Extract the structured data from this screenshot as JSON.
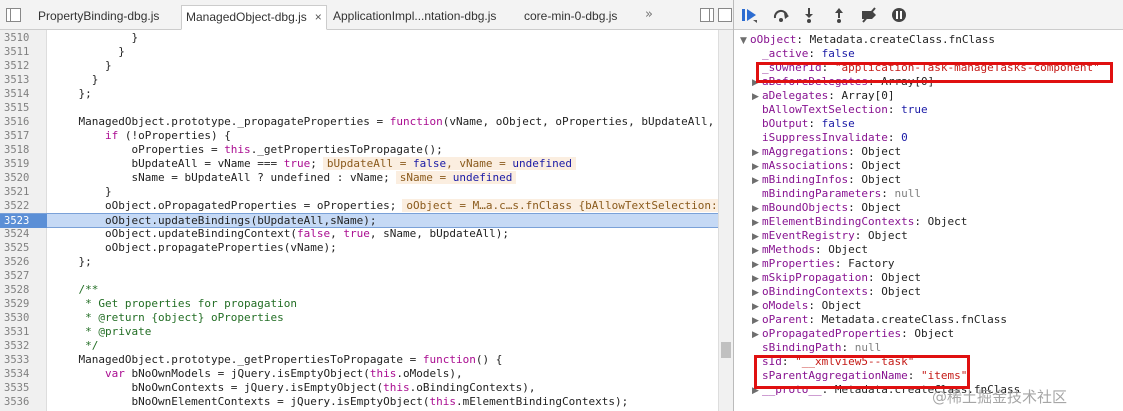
{
  "tabs": [
    {
      "label": "PropertyBinding-dbg.js",
      "active": false
    },
    {
      "label": "ManagedObject-dbg.js",
      "active": true,
      "close": "×"
    },
    {
      "label": "ApplicationImpl...ntation-dbg.js",
      "active": false
    },
    {
      "label": "core-min-0-dbg.js",
      "active": false
    }
  ],
  "tabbar": {
    "overflow": "»"
  },
  "editor": {
    "lines": [
      {
        "no": "3510",
        "html": "            }"
      },
      {
        "no": "3511",
        "html": "          }"
      },
      {
        "no": "3512",
        "html": "        }"
      },
      {
        "no": "3513",
        "html": "      }"
      },
      {
        "no": "3514",
        "html": "    };"
      },
      {
        "no": "3515",
        "html": ""
      },
      {
        "no": "3516",
        "html": "    ManagedObject.prototype._propagateProperties = <span class=\"kw\">function</span>(vName, oObject, oProperties, bUpdateAll,"
      },
      {
        "no": "3517",
        "html": "        <span class=\"kw\">if</span> (!oProperties) {"
      },
      {
        "no": "3518",
        "html": "            oProperties = <span class=\"kw\">this</span>._getPropertiesToPropagate();"
      },
      {
        "no": "3519",
        "html": "            bUpdateAll = vName === <span class=\"kw\">true</span>;<span class=\"inl\">bUpdateAll = <span class=\"v\">false</span>, vName = <span class=\"v\">undefined</span></span>"
      },
      {
        "no": "3520",
        "html": "            sName = bUpdateAll ? undefined : vName;<span class=\"inl\">sName = <span class=\"v\">undefined</span></span>"
      },
      {
        "no": "3521",
        "html": "        }"
      },
      {
        "no": "3522",
        "html": "        oObject.oPropagatedProperties = oProperties;<span class=\"inl\">oObject = M…a.c…s.fnClass {bAllowTextSelection:</span>"
      },
      {
        "no": "3523",
        "html": "        oObject.updateBindings(bUpdateAll,sName);",
        "exec": true
      },
      {
        "no": "3524",
        "html": "        oObject.updateBindingContext(<span class=\"kw\">false</span>, <span class=\"kw\">true</span>, sName, bUpdateAll);"
      },
      {
        "no": "3525",
        "html": "        oObject.propagateProperties(vName);"
      },
      {
        "no": "3526",
        "html": "    };"
      },
      {
        "no": "3527",
        "html": ""
      },
      {
        "no": "3528",
        "html": "    <span class=\"cmt\">/**</span>"
      },
      {
        "no": "3529",
        "html": "<span class=\"cmt\">     * Get properties for propagation</span>"
      },
      {
        "no": "3530",
        "html": "<span class=\"cmt\">     * @return {object} oProperties</span>"
      },
      {
        "no": "3531",
        "html": "<span class=\"cmt\">     * @private</span>"
      },
      {
        "no": "3532",
        "html": "<span class=\"cmt\">     */</span>"
      },
      {
        "no": "3533",
        "html": "    ManagedObject.prototype._getPropertiesToPropagate = <span class=\"kw\">function</span>() {"
      },
      {
        "no": "3534",
        "html": "        <span class=\"kw\">var</span> bNoOwnModels = jQuery.isEmptyObject(<span class=\"kw\">this</span>.oModels),"
      },
      {
        "no": "3535",
        "html": "            bNoOwnContexts = jQuery.isEmptyObject(<span class=\"kw\">this</span>.oBindingContexts),"
      },
      {
        "no": "3536",
        "html": "            bNoOwnElementContexts = jQuery.isEmptyObject(<span class=\"kw\">this</span>.mElementBindingContexts);"
      }
    ]
  },
  "scope": {
    "items": [
      {
        "tri": "▼",
        "key": "oObject",
        "val": "Metadata.createClass.fnClass",
        "vt": "obj",
        "indent": 0
      },
      {
        "tri": "",
        "key": "_active",
        "val": "false",
        "vt": "bool",
        "indent": 1
      },
      {
        "tri": "",
        "key": "_sOwnerId",
        "val": "\"application-Task-manageTasks-component\"",
        "vt": "str",
        "indent": 1
      },
      {
        "tri": "▶",
        "key": "aBeforeDelegates",
        "val": "Array[0]",
        "vt": "obj",
        "indent": 1
      },
      {
        "tri": "▶",
        "key": "aDelegates",
        "val": "Array[0]",
        "vt": "obj",
        "indent": 1
      },
      {
        "tri": "",
        "key": "bAllowTextSelection",
        "val": "true",
        "vt": "bool",
        "indent": 1
      },
      {
        "tri": "",
        "key": "bOutput",
        "val": "false",
        "vt": "bool",
        "indent": 1
      },
      {
        "tri": "",
        "key": "iSuppressInvalidate",
        "val": "0",
        "vt": "num",
        "indent": 1
      },
      {
        "tri": "▶",
        "key": "mAggregations",
        "val": "Object",
        "vt": "obj",
        "indent": 1
      },
      {
        "tri": "▶",
        "key": "mAssociations",
        "val": "Object",
        "vt": "obj",
        "indent": 1
      },
      {
        "tri": "▶",
        "key": "mBindingInfos",
        "val": "Object",
        "vt": "obj",
        "indent": 1
      },
      {
        "tri": "",
        "key": "mBindingParameters",
        "val": "null",
        "vt": "null",
        "indent": 1
      },
      {
        "tri": "▶",
        "key": "mBoundObjects",
        "val": "Object",
        "vt": "obj",
        "indent": 1
      },
      {
        "tri": "▶",
        "key": "mElementBindingContexts",
        "val": "Object",
        "vt": "obj",
        "indent": 1
      },
      {
        "tri": "▶",
        "key": "mEventRegistry",
        "val": "Object",
        "vt": "obj",
        "indent": 1
      },
      {
        "tri": "▶",
        "key": "mMethods",
        "val": "Object",
        "vt": "obj",
        "indent": 1
      },
      {
        "tri": "▶",
        "key": "mProperties",
        "val": "Factory",
        "vt": "obj",
        "indent": 1
      },
      {
        "tri": "▶",
        "key": "mSkipPropagation",
        "val": "Object",
        "vt": "obj",
        "indent": 1
      },
      {
        "tri": "▶",
        "key": "oBindingContexts",
        "val": "Object",
        "vt": "obj",
        "indent": 1
      },
      {
        "tri": "▶",
        "key": "oModels",
        "val": "Object",
        "vt": "obj",
        "indent": 1
      },
      {
        "tri": "▶",
        "key": "oParent",
        "val": "Metadata.createClass.fnClass",
        "vt": "obj",
        "indent": 1
      },
      {
        "tri": "▶",
        "key": "oPropagatedProperties",
        "val": "Object",
        "vt": "obj",
        "indent": 1
      },
      {
        "tri": "",
        "key": "sBindingPath",
        "val": "null",
        "vt": "null",
        "indent": 1
      },
      {
        "tri": "",
        "key": "sId",
        "val": "\"__xmlview5--task\"",
        "vt": "str",
        "indent": 1
      },
      {
        "tri": "",
        "key": "sParentAggregationName",
        "val": "\"items\"",
        "vt": "str",
        "indent": 1
      },
      {
        "tri": "▶",
        "key": "__proto__",
        "val": "Metadata.createClass.fnClass",
        "vt": "obj",
        "indent": 1
      }
    ]
  },
  "watermark": "@稀土掘金技术社区",
  "colors": {
    "highlight_box": "#e01010",
    "exec_line": "#c5d9f5"
  }
}
